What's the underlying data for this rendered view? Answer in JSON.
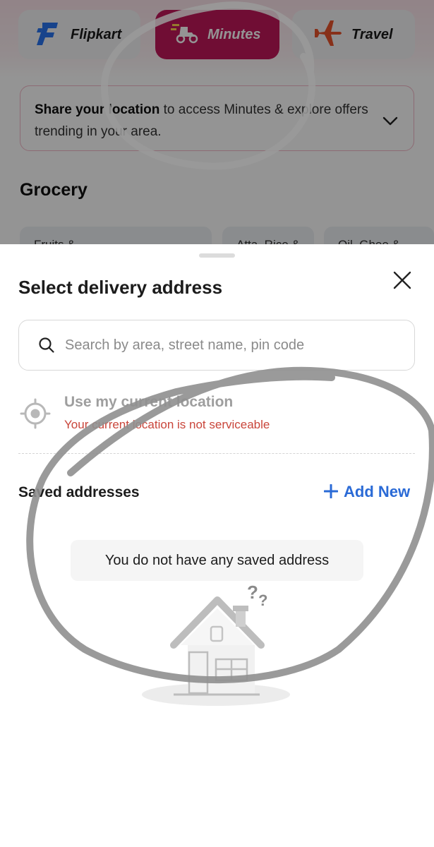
{
  "background": {
    "tabs": [
      {
        "label": "Flipkart",
        "icon": "flipkart-logo-icon",
        "selected": false
      },
      {
        "label": "Minutes",
        "icon": "scooter-icon",
        "selected": true
      },
      {
        "label": "Travel",
        "icon": "airplane-icon",
        "selected": false
      }
    ],
    "location_prompt": {
      "bold": "Share your location",
      "rest": " to access Minutes & explore offers trending in your area."
    },
    "section_title": "Grocery",
    "categories": [
      "Fruits &",
      "Atta, Rice &",
      "Oil, Ghee &"
    ]
  },
  "sheet": {
    "title": "Select delivery address",
    "search": {
      "placeholder": "Search by area, street name, pin code",
      "value": ""
    },
    "current_location": {
      "label": "Use my current location",
      "error": "Your current location is not serviceable"
    },
    "saved": {
      "title": "Saved addresses",
      "add_new_label": "Add New",
      "empty_message": "You do not have any saved address"
    }
  },
  "colors": {
    "minutes_tab": "#c2185b",
    "accent_blue": "#2a6ad6",
    "error_red": "#c9453a"
  }
}
